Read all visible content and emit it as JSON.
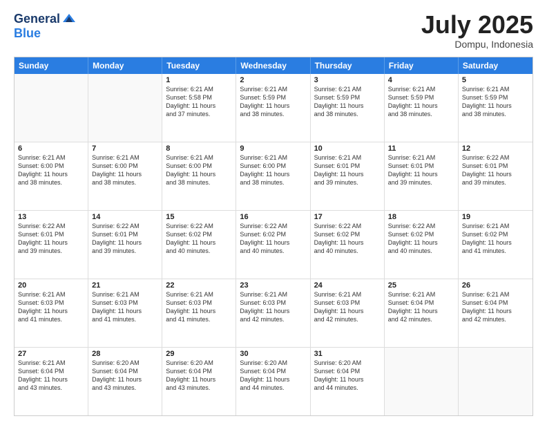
{
  "logo": {
    "general": "General",
    "blue": "Blue"
  },
  "title": "July 2025",
  "location": "Dompu, Indonesia",
  "header_days": [
    "Sunday",
    "Monday",
    "Tuesday",
    "Wednesday",
    "Thursday",
    "Friday",
    "Saturday"
  ],
  "weeks": [
    [
      {
        "day": "",
        "lines": []
      },
      {
        "day": "",
        "lines": []
      },
      {
        "day": "1",
        "lines": [
          "Sunrise: 6:21 AM",
          "Sunset: 5:58 PM",
          "Daylight: 11 hours",
          "and 37 minutes."
        ]
      },
      {
        "day": "2",
        "lines": [
          "Sunrise: 6:21 AM",
          "Sunset: 5:59 PM",
          "Daylight: 11 hours",
          "and 38 minutes."
        ]
      },
      {
        "day": "3",
        "lines": [
          "Sunrise: 6:21 AM",
          "Sunset: 5:59 PM",
          "Daylight: 11 hours",
          "and 38 minutes."
        ]
      },
      {
        "day": "4",
        "lines": [
          "Sunrise: 6:21 AM",
          "Sunset: 5:59 PM",
          "Daylight: 11 hours",
          "and 38 minutes."
        ]
      },
      {
        "day": "5",
        "lines": [
          "Sunrise: 6:21 AM",
          "Sunset: 5:59 PM",
          "Daylight: 11 hours",
          "and 38 minutes."
        ]
      }
    ],
    [
      {
        "day": "6",
        "lines": [
          "Sunrise: 6:21 AM",
          "Sunset: 6:00 PM",
          "Daylight: 11 hours",
          "and 38 minutes."
        ]
      },
      {
        "day": "7",
        "lines": [
          "Sunrise: 6:21 AM",
          "Sunset: 6:00 PM",
          "Daylight: 11 hours",
          "and 38 minutes."
        ]
      },
      {
        "day": "8",
        "lines": [
          "Sunrise: 6:21 AM",
          "Sunset: 6:00 PM",
          "Daylight: 11 hours",
          "and 38 minutes."
        ]
      },
      {
        "day": "9",
        "lines": [
          "Sunrise: 6:21 AM",
          "Sunset: 6:00 PM",
          "Daylight: 11 hours",
          "and 38 minutes."
        ]
      },
      {
        "day": "10",
        "lines": [
          "Sunrise: 6:21 AM",
          "Sunset: 6:01 PM",
          "Daylight: 11 hours",
          "and 39 minutes."
        ]
      },
      {
        "day": "11",
        "lines": [
          "Sunrise: 6:21 AM",
          "Sunset: 6:01 PM",
          "Daylight: 11 hours",
          "and 39 minutes."
        ]
      },
      {
        "day": "12",
        "lines": [
          "Sunrise: 6:22 AM",
          "Sunset: 6:01 PM",
          "Daylight: 11 hours",
          "and 39 minutes."
        ]
      }
    ],
    [
      {
        "day": "13",
        "lines": [
          "Sunrise: 6:22 AM",
          "Sunset: 6:01 PM",
          "Daylight: 11 hours",
          "and 39 minutes."
        ]
      },
      {
        "day": "14",
        "lines": [
          "Sunrise: 6:22 AM",
          "Sunset: 6:01 PM",
          "Daylight: 11 hours",
          "and 39 minutes."
        ]
      },
      {
        "day": "15",
        "lines": [
          "Sunrise: 6:22 AM",
          "Sunset: 6:02 PM",
          "Daylight: 11 hours",
          "and 40 minutes."
        ]
      },
      {
        "day": "16",
        "lines": [
          "Sunrise: 6:22 AM",
          "Sunset: 6:02 PM",
          "Daylight: 11 hours",
          "and 40 minutes."
        ]
      },
      {
        "day": "17",
        "lines": [
          "Sunrise: 6:22 AM",
          "Sunset: 6:02 PM",
          "Daylight: 11 hours",
          "and 40 minutes."
        ]
      },
      {
        "day": "18",
        "lines": [
          "Sunrise: 6:22 AM",
          "Sunset: 6:02 PM",
          "Daylight: 11 hours",
          "and 40 minutes."
        ]
      },
      {
        "day": "19",
        "lines": [
          "Sunrise: 6:21 AM",
          "Sunset: 6:02 PM",
          "Daylight: 11 hours",
          "and 41 minutes."
        ]
      }
    ],
    [
      {
        "day": "20",
        "lines": [
          "Sunrise: 6:21 AM",
          "Sunset: 6:03 PM",
          "Daylight: 11 hours",
          "and 41 minutes."
        ]
      },
      {
        "day": "21",
        "lines": [
          "Sunrise: 6:21 AM",
          "Sunset: 6:03 PM",
          "Daylight: 11 hours",
          "and 41 minutes."
        ]
      },
      {
        "day": "22",
        "lines": [
          "Sunrise: 6:21 AM",
          "Sunset: 6:03 PM",
          "Daylight: 11 hours",
          "and 41 minutes."
        ]
      },
      {
        "day": "23",
        "lines": [
          "Sunrise: 6:21 AM",
          "Sunset: 6:03 PM",
          "Daylight: 11 hours",
          "and 42 minutes."
        ]
      },
      {
        "day": "24",
        "lines": [
          "Sunrise: 6:21 AM",
          "Sunset: 6:03 PM",
          "Daylight: 11 hours",
          "and 42 minutes."
        ]
      },
      {
        "day": "25",
        "lines": [
          "Sunrise: 6:21 AM",
          "Sunset: 6:04 PM",
          "Daylight: 11 hours",
          "and 42 minutes."
        ]
      },
      {
        "day": "26",
        "lines": [
          "Sunrise: 6:21 AM",
          "Sunset: 6:04 PM",
          "Daylight: 11 hours",
          "and 42 minutes."
        ]
      }
    ],
    [
      {
        "day": "27",
        "lines": [
          "Sunrise: 6:21 AM",
          "Sunset: 6:04 PM",
          "Daylight: 11 hours",
          "and 43 minutes."
        ]
      },
      {
        "day": "28",
        "lines": [
          "Sunrise: 6:20 AM",
          "Sunset: 6:04 PM",
          "Daylight: 11 hours",
          "and 43 minutes."
        ]
      },
      {
        "day": "29",
        "lines": [
          "Sunrise: 6:20 AM",
          "Sunset: 6:04 PM",
          "Daylight: 11 hours",
          "and 43 minutes."
        ]
      },
      {
        "day": "30",
        "lines": [
          "Sunrise: 6:20 AM",
          "Sunset: 6:04 PM",
          "Daylight: 11 hours",
          "and 44 minutes."
        ]
      },
      {
        "day": "31",
        "lines": [
          "Sunrise: 6:20 AM",
          "Sunset: 6:04 PM",
          "Daylight: 11 hours",
          "and 44 minutes."
        ]
      },
      {
        "day": "",
        "lines": []
      },
      {
        "day": "",
        "lines": []
      }
    ]
  ]
}
